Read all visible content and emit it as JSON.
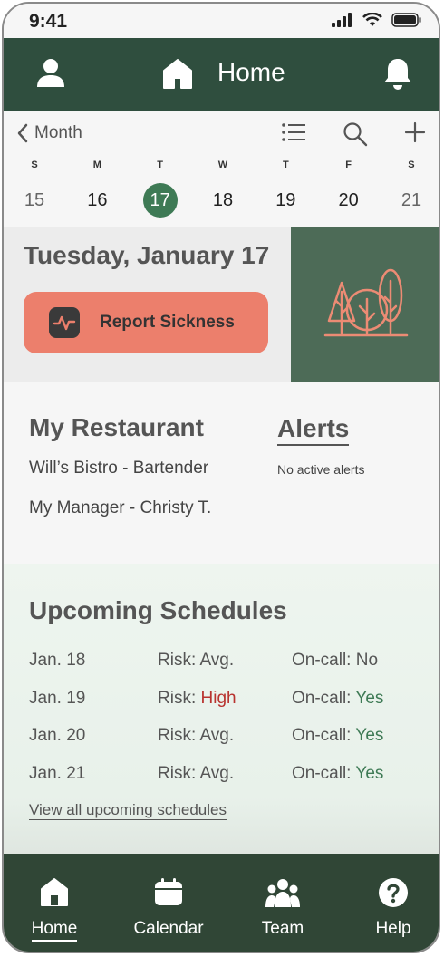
{
  "status_bar": {
    "time": "9:41"
  },
  "header": {
    "title": "Home"
  },
  "calendar": {
    "back_label": "Month",
    "days": [
      {
        "dow": "S",
        "num": "15"
      },
      {
        "dow": "M",
        "num": "16"
      },
      {
        "dow": "T",
        "num": "17"
      },
      {
        "dow": "W",
        "num": "18"
      },
      {
        "dow": "T",
        "num": "19"
      },
      {
        "dow": "F",
        "num": "20"
      },
      {
        "dow": "S",
        "num": "21"
      }
    ],
    "selected_index": 2
  },
  "today": {
    "date": "Tuesday, January 17",
    "report_sickness_label": "Report Sickness"
  },
  "restaurant": {
    "heading": "My Restaurant",
    "position": "Will’s Bistro - Bartender",
    "manager": "My Manager - Christy T."
  },
  "alerts": {
    "heading": "Alerts",
    "message": "No active alerts"
  },
  "schedules": {
    "heading": "Upcoming Schedules",
    "risk_prefix": "Risk: ",
    "oncall_prefix": "On-call: ",
    "rows": [
      {
        "date": "Jan. 18",
        "risk": "Avg.",
        "oncall": "No"
      },
      {
        "date": "Jan. 19",
        "risk": "High",
        "oncall": "Yes"
      },
      {
        "date": "Jan. 20",
        "risk": "Avg.",
        "oncall": "Yes"
      },
      {
        "date": "Jan. 21",
        "risk": "Avg.",
        "oncall": "Yes"
      }
    ],
    "view_all": "View all upcoming schedules"
  },
  "tabbar": {
    "home": "Home",
    "calendar": "Calendar",
    "team": "Team",
    "help": "Help"
  },
  "colors": {
    "header": "#2f4e3e",
    "accent_green": "#3e7a55",
    "sickness_button": "#ec7f6c",
    "high_risk": "#b8332f",
    "tabbar": "#304636"
  }
}
